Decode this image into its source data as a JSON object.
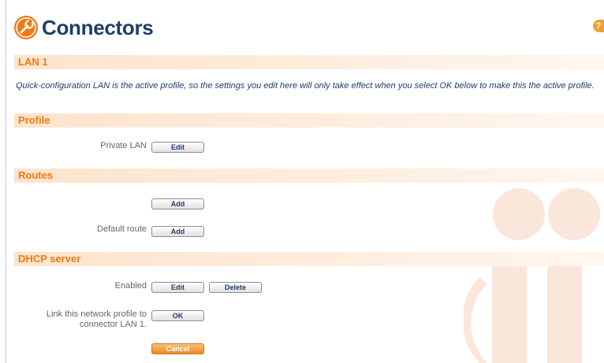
{
  "header": {
    "title": "Connectors",
    "logo_icon": "wrench-circle-icon",
    "help_icon": "help-icon",
    "accent_color": "#f07a10"
  },
  "sections": {
    "lan": {
      "title": "LAN 1"
    },
    "profile": {
      "title": "Profile"
    },
    "routes": {
      "title": "Routes"
    },
    "dhcp": {
      "title": "DHCP server"
    }
  },
  "notice": "Quick-configuration LAN is the active profile, so the settings you edit here will only take effect when you select OK below to make this the active profile.",
  "profile": {
    "label": "Private LAN",
    "edit_label": "Edit"
  },
  "routes": {
    "add_label": "Add",
    "default_route_label": "Default route",
    "default_add_label": "Add"
  },
  "dhcp": {
    "enabled_label": "Enabled",
    "edit_label": "Edit",
    "delete_label": "Delete",
    "link_label_line1": "Link this network profile to",
    "link_label_line2": "connector LAN 1.",
    "ok_label": "OK",
    "cancel_label": "Cancel"
  }
}
